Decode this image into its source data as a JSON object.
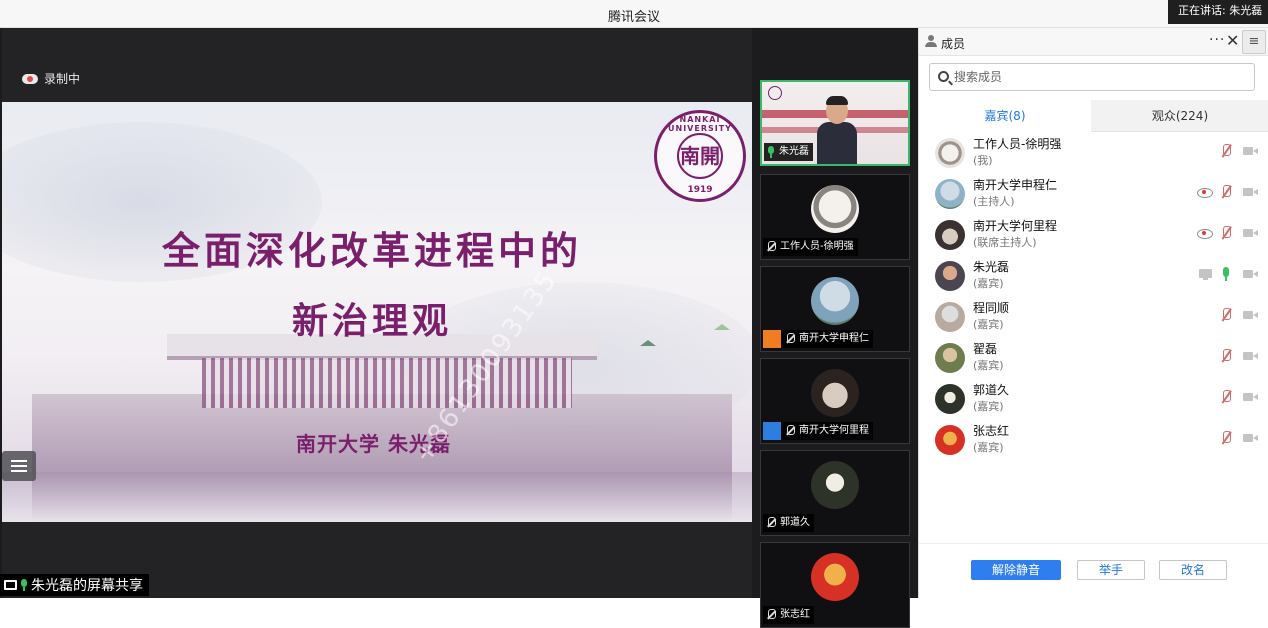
{
  "window": {
    "title": "腾讯会议",
    "speaking_indicator": "正在讲话: 朱光磊"
  },
  "stage": {
    "recording_label": "录制中",
    "share_label": "朱光磊的屏幕共享",
    "slide": {
      "headline_line1": "全面深化改革进程中的",
      "headline_line2": "新治理观",
      "author": "南开大学 朱光磊",
      "seal_ring": "NANKAI UNIVERSITY",
      "seal_char": "南開",
      "seal_year": "1919",
      "watermark": "+86130093135"
    }
  },
  "video_tiles": [
    {
      "name": "朱光磊",
      "active": true,
      "mic": "on"
    },
    {
      "name": "工作人员-徐明强",
      "mic": "off"
    },
    {
      "name": "南开大学申程仁",
      "mic": "off",
      "role": "host"
    },
    {
      "name": "南开大学何里程",
      "mic": "off",
      "role": "cohost"
    },
    {
      "name": "郭道久",
      "mic": "off"
    },
    {
      "name": "张志红",
      "mic": "off"
    }
  ],
  "panel": {
    "title": "成员",
    "more_label": "···",
    "close_label": "✕",
    "menu_label": "≡",
    "search_placeholder": "搜索成员",
    "tabs": [
      {
        "label": "嘉宾(8)",
        "selected": true
      },
      {
        "label": "观众(224)",
        "selected": false
      }
    ],
    "members": [
      {
        "name": "工作人员-徐明强",
        "role": "(我)",
        "avatar_color": "#e8e3df",
        "icons": [
          "mic-off",
          "cam-off"
        ]
      },
      {
        "name": "南开大学申程仁",
        "role": "(主持人)",
        "avatar_color": "#8fb2c9",
        "icons": [
          "eye",
          "mic-off",
          "cam-off"
        ]
      },
      {
        "name": "南开大学何里程",
        "role": "(联席主持人)",
        "avatar_color": "#3a3230",
        "icons": [
          "eye",
          "mic-off",
          "cam-off"
        ]
      },
      {
        "name": "朱光磊",
        "role": "(嘉宾)",
        "avatar_color": "#4a4550",
        "icons": [
          "screen",
          "mic-on",
          "cam-off"
        ]
      },
      {
        "name": "程同顺",
        "role": "(嘉宾)",
        "avatar_color": "#b9aaa0",
        "icons": [
          "mic-off",
          "cam-off"
        ]
      },
      {
        "name": "翟磊",
        "role": "(嘉宾)",
        "avatar_color": "#6f7d4e",
        "icons": [
          "mic-off",
          "cam-off"
        ]
      },
      {
        "name": "郭道久",
        "role": "(嘉宾)",
        "avatar_color": "#2d3328",
        "icons": [
          "mic-off",
          "cam-off"
        ]
      },
      {
        "name": "张志红",
        "role": "(嘉宾)",
        "avatar_color": "#d73025",
        "icons": [
          "mic-off",
          "cam-off"
        ]
      }
    ],
    "buttons": {
      "unmute_all": "解除静音",
      "raise_hand": "举手",
      "rename": "改名"
    }
  },
  "colors": {
    "accent": "#2476e0",
    "slide_title": "#7a1f6c",
    "active_border": "#3bb76a"
  }
}
